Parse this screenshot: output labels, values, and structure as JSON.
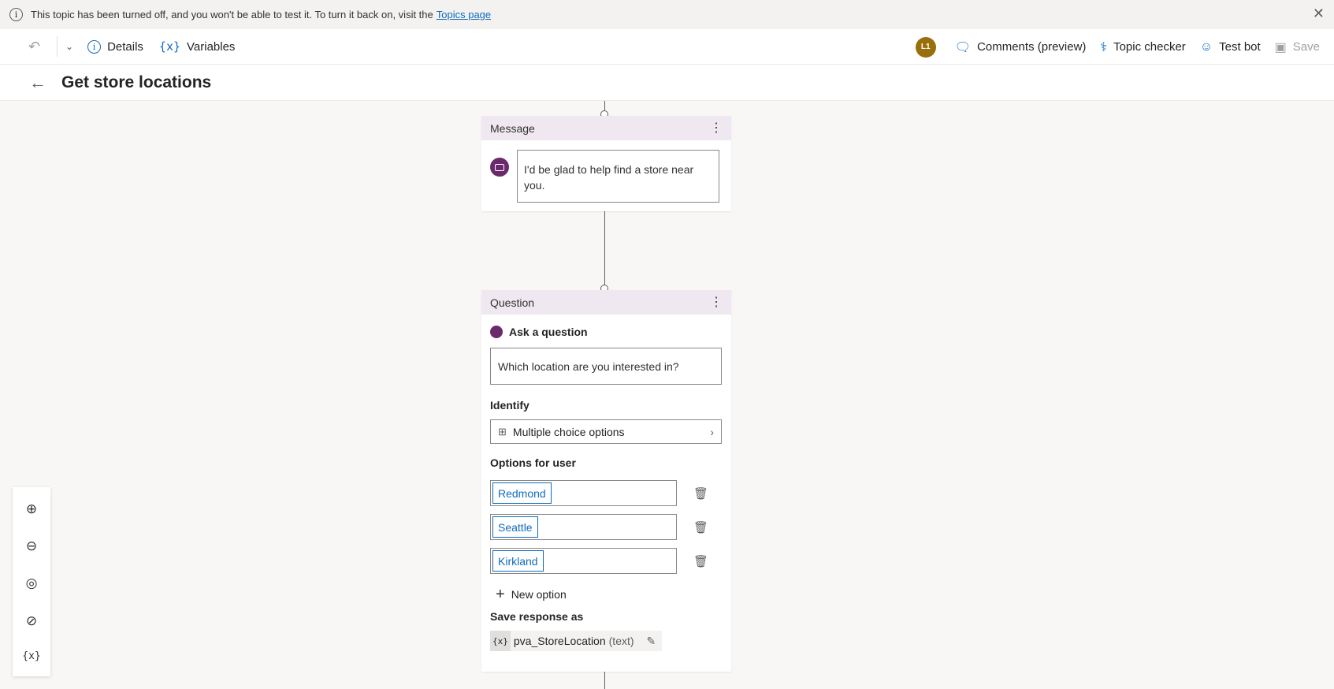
{
  "banner": {
    "message": "This topic has been turned off, and you won't be able to test it. To turn it back on, visit the",
    "link_text": "Topics page"
  },
  "toolbar": {
    "details_label": "Details",
    "variables_icon": "{x}",
    "variables_label": "Variables",
    "avatar_initials": "L1",
    "comments_label": "Comments (preview)",
    "topic_checker_label": "Topic checker",
    "test_bot_label": "Test bot",
    "save_label": "Save"
  },
  "page": {
    "title": "Get store locations"
  },
  "message_node": {
    "header": "Message",
    "text": "I'd be glad to help find a store near you."
  },
  "question_node": {
    "header": "Question",
    "ask_label": "Ask a question",
    "question_text": "Which location are you interested in?",
    "identify_label": "Identify",
    "identify_value": "Multiple choice options",
    "options_label": "Options for user",
    "options": [
      "Redmond",
      "Seattle",
      "Kirkland"
    ],
    "new_option_label": "New option",
    "save_response_label": "Save response as",
    "variable_icon": "{x}",
    "variable_name": "pva_StoreLocation",
    "variable_type": "(text)"
  },
  "zoom_panel": {
    "variables_icon": "{x}"
  },
  "icons": {
    "undo": "undo-icon",
    "chevron": "chevron-down-icon",
    "info": "info-icon",
    "comments": "comment-icon",
    "checker": "stethoscope-icon",
    "bot": "bot-icon",
    "save": "save-icon",
    "back": "back-arrow-icon",
    "trash": "trash-icon",
    "pencil": "pencil-icon"
  },
  "colors": {
    "accent": "#0f6cbd",
    "node_header": "#efe8f1",
    "avatar": "#986f0b",
    "message_icon": "#6b2a6b"
  }
}
